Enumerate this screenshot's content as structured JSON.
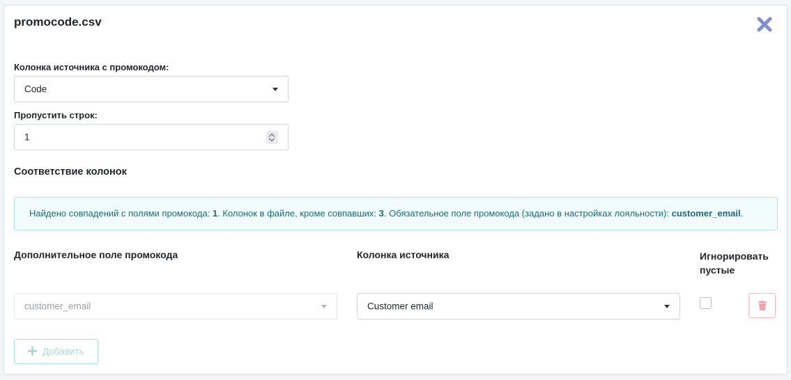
{
  "dialog": {
    "title": "promocode.csv"
  },
  "source_column": {
    "label": "Колонка источника с промокодом:",
    "value": "Code"
  },
  "skip_rows": {
    "label": "Пропустить строк:",
    "value": "1"
  },
  "mapping": {
    "heading": "Соответствие колонок"
  },
  "alert": {
    "text1": "Найдено совпадений с полями промокода: ",
    "matches": "1",
    "text2": ". Колонок в файле, кроме совпавших: ",
    "other_columns": "3",
    "text3": ". Обязательное поле промокода (задано в настройках лояльности): ",
    "required_field": "customer_email",
    "text4": "."
  },
  "columns": {
    "extra_field": "Дополнительное поле промокода",
    "source_column": "Колонка источника",
    "ignore_empty_line1": "Игнорировать",
    "ignore_empty_line2": "пустые"
  },
  "row": {
    "promo_field": "customer_email",
    "source_value": "Customer email"
  },
  "actions": {
    "add_label": "Добавить"
  },
  "colors": {
    "accent": "#5b6fb8",
    "info_text": "#1e6a78",
    "info_bg": "#f1fbfb",
    "danger": "#f0b8bd",
    "teal_light": "#a9dcd8"
  },
  "icons": {
    "close": "close-icon",
    "caret": "chevron-down-icon",
    "trash": "trash-icon",
    "plus": "plus-icon"
  }
}
